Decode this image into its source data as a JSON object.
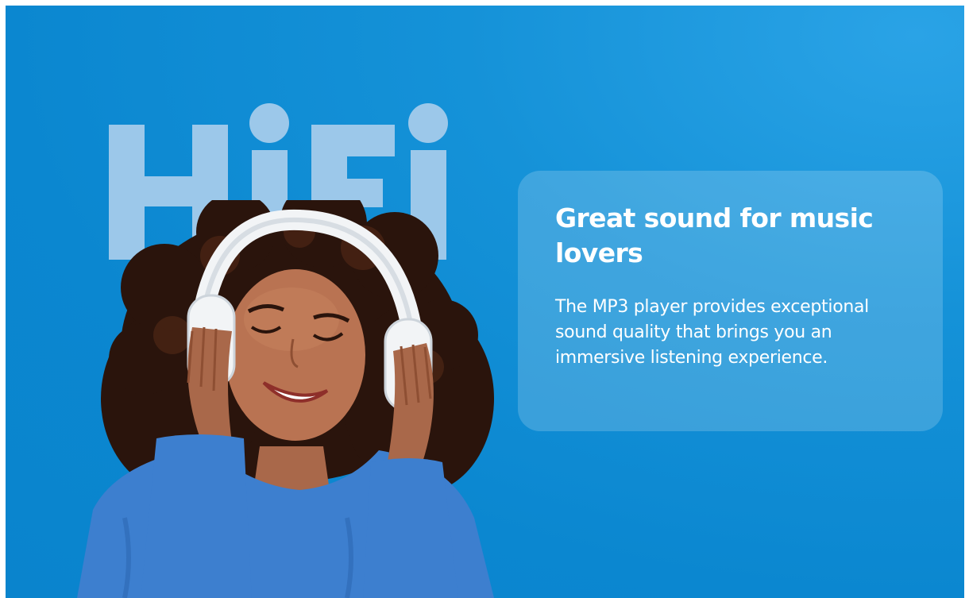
{
  "hero": {
    "logo_text": "HiFi",
    "colors": {
      "background": "#0b87d0",
      "logo": "#9cc8ea",
      "card_text": "#ffffff",
      "sweater": "#3d7fcf",
      "headphones": "#f2f4f6"
    },
    "image": {
      "icon": "woman-with-headphones-image"
    }
  },
  "card": {
    "title": "Great sound for music lovers",
    "description": "The MP3 player provides exceptional sound quality that brings you an immersive listening experience."
  }
}
